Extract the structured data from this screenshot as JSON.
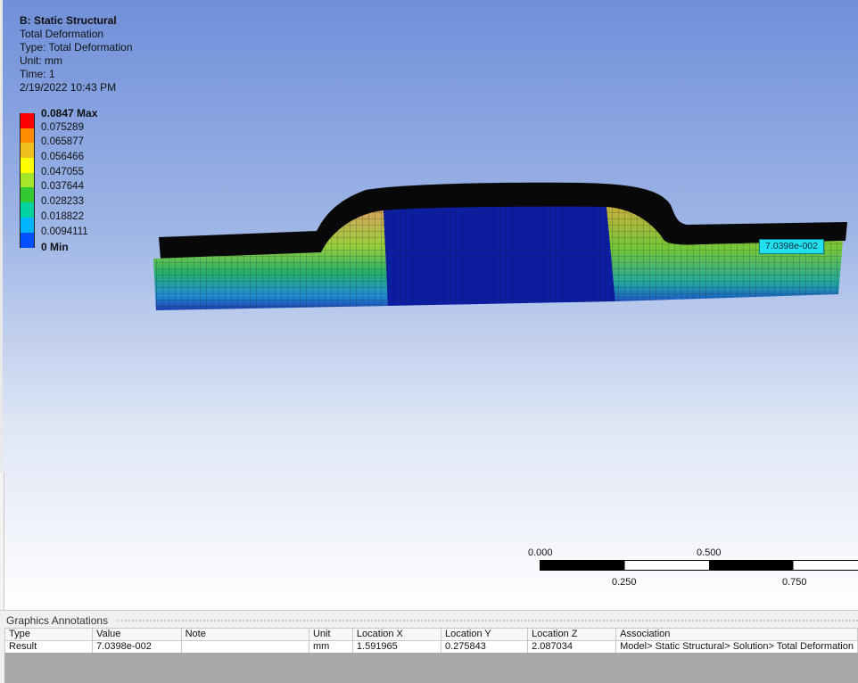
{
  "result_info": {
    "system": "B: Static Structural",
    "result_name": "Total Deformation",
    "type_line": "Type: Total Deformation",
    "unit_line": "Unit: mm",
    "time_line": "Time: 1",
    "timestamp": "2/19/2022 10:43 PM"
  },
  "legend": {
    "max_label": "0.0847 Max",
    "min_label": "0 Min",
    "levels": [
      "0.0847 Max",
      "0.075289",
      "0.065877",
      "0.056466",
      "0.047055",
      "0.037644",
      "0.028233",
      "0.018822",
      "0.0094111",
      "0 Min"
    ],
    "colors": [
      "#ff0000",
      "#ff8c00",
      "#f0c020",
      "#ffff00",
      "#a6e62a",
      "#32c832",
      "#00d2a0",
      "#00b4ff",
      "#0050ff"
    ]
  },
  "probe": {
    "value": "7.0398e-002"
  },
  "scale": {
    "top_left": "0.000",
    "top_mid": "0.500",
    "bottom_a": "0.250",
    "bottom_b": "0.750"
  },
  "annotations": {
    "title": "Graphics Annotations",
    "columns": [
      "Type",
      "Value",
      "Note",
      "Unit",
      "Location X",
      "Location Y",
      "Location Z",
      "Association"
    ],
    "rows": [
      [
        "Result",
        "7.0398e-002",
        "",
        "mm",
        "1.591965",
        "0.275843",
        "2.087034",
        "Model> Static Structural> Solution> Total Deformation"
      ]
    ]
  }
}
